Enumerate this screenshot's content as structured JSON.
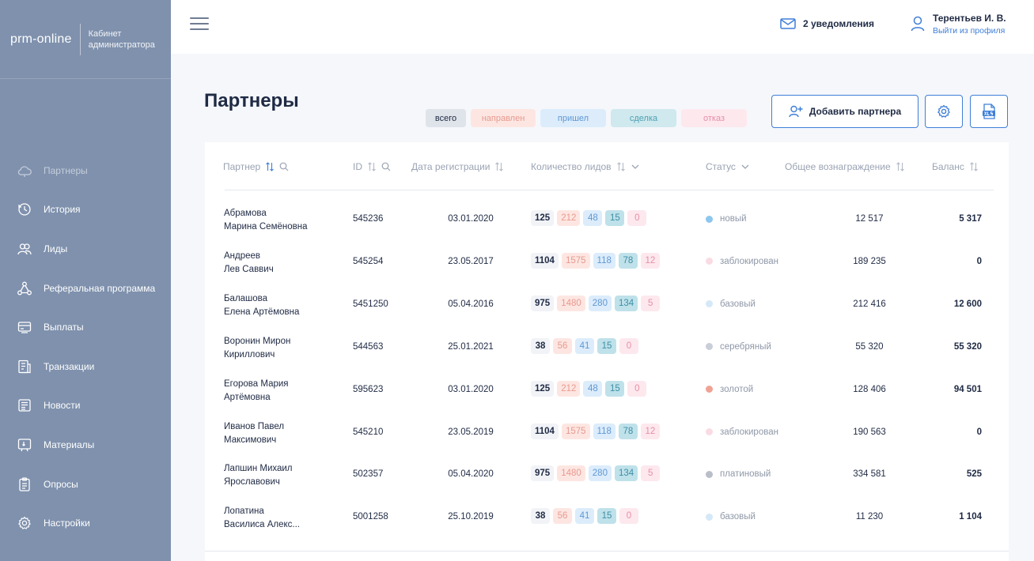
{
  "sidebar": {
    "logo": "prm-online",
    "cabinet_line1": "Кабинет",
    "cabinet_line2": "администратора",
    "items": [
      {
        "label": "Партнеры",
        "icon": "cloud-icon"
      },
      {
        "label": "История",
        "icon": "history-icon"
      },
      {
        "label": "Лиды",
        "icon": "users-icon"
      },
      {
        "label": "Реферальная программа",
        "icon": "network-icon"
      },
      {
        "label": "Выплаты",
        "icon": "payments-icon"
      },
      {
        "label": "Транзакции",
        "icon": "receipt-icon"
      },
      {
        "label": "Новости",
        "icon": "news-icon"
      },
      {
        "label": "Материалы",
        "icon": "materials-icon"
      },
      {
        "label": "Опросы",
        "icon": "clipboard-icon"
      },
      {
        "label": "Настройки",
        "icon": "gear-icon"
      }
    ]
  },
  "header": {
    "notifications": "2 уведомления",
    "user_name": "Терентьев И. В.",
    "logout": "Выйти из профиля"
  },
  "page": {
    "title": "Партнеры",
    "filters": {
      "all": "всего",
      "sent": "направлен",
      "came": "пришел",
      "deal": "сделка",
      "refuse": "отказ"
    },
    "add_partner": "Добавить партнера"
  },
  "table": {
    "columns": {
      "partner": "Партнер",
      "id": "ID",
      "reg_date": "Дата регистрации",
      "leads": "Количество лидов",
      "status": "Статус",
      "reward": "Общее вознаграждение",
      "balance": "Баланс"
    },
    "rows": [
      {
        "name1": "Абрамова",
        "name2": "Марина Семёновна",
        "id": "545236",
        "date": "03.01.2020",
        "total": "125",
        "sent": "212",
        "came": "48",
        "deal": "15",
        "refuse": "0",
        "status": "новый",
        "status_color": "#8cc7f0",
        "reward": "12 517",
        "balance": "5 317"
      },
      {
        "name1": "Андреев",
        "name2": "Лев Саввич",
        "id": "545254",
        "date": "23.05.2017",
        "total": "1104",
        "sent": "1575",
        "came": "118",
        "deal": "78",
        "refuse": "12",
        "status": "заблокирован",
        "status_color": "#fadbe3",
        "reward": "189 235",
        "balance": "0"
      },
      {
        "name1": "Балашова",
        "name2": "Елена Артёмовна",
        "id": "5451250",
        "date": "05.04.2016",
        "total": "975",
        "sent": "1480",
        "came": "280",
        "deal": "134",
        "refuse": "5",
        "status": "базовый",
        "status_color": "#d4e8f8",
        "reward": "212 416",
        "balance": "12 600"
      },
      {
        "name1": "Воронин Мирон",
        "name2": "Кириллович",
        "id": "544563",
        "date": "25.01.2021",
        "total": "38",
        "sent": "56",
        "came": "41",
        "deal": "15",
        "refuse": "0",
        "status": "серебряный",
        "status_color": "#c9ced8",
        "reward": "55 320",
        "balance": "55 320"
      },
      {
        "name1": "Егорова Мария",
        "name2": "Артёмовна",
        "id": "595623",
        "date": "03.01.2020",
        "total": "125",
        "sent": "212",
        "came": "48",
        "deal": "15",
        "refuse": "0",
        "status": "золотой",
        "status_color": "#f0a394",
        "reward": "128 406",
        "balance": "94 501"
      },
      {
        "name1": "Иванов Павел",
        "name2": "Максимович",
        "id": "545210",
        "date": "23.05.2019",
        "total": "1104",
        "sent": "1575",
        "came": "118",
        "deal": "78",
        "refuse": "12",
        "status": "заблокирован",
        "status_color": "#fadbe3",
        "reward": "190 563",
        "balance": "0"
      },
      {
        "name1": "Лапшин Михаил",
        "name2": "Ярославович",
        "id": "502357",
        "date": "05.04.2020",
        "total": "975",
        "sent": "1480",
        "came": "280",
        "deal": "134",
        "refuse": "5",
        "status": "платиновый",
        "status_color": "#b9bec8",
        "reward": "334 581",
        "balance": "525"
      },
      {
        "name1": "Лопатина",
        "name2": "Василиса Алекс...",
        "id": "5001258",
        "date": "25.10.2019",
        "total": "38",
        "sent": "56",
        "came": "41",
        "deal": "15",
        "refuse": "0",
        "status": "базовый",
        "status_color": "#d4e8f8",
        "reward": "11 230",
        "balance": "1 104"
      }
    ]
  }
}
